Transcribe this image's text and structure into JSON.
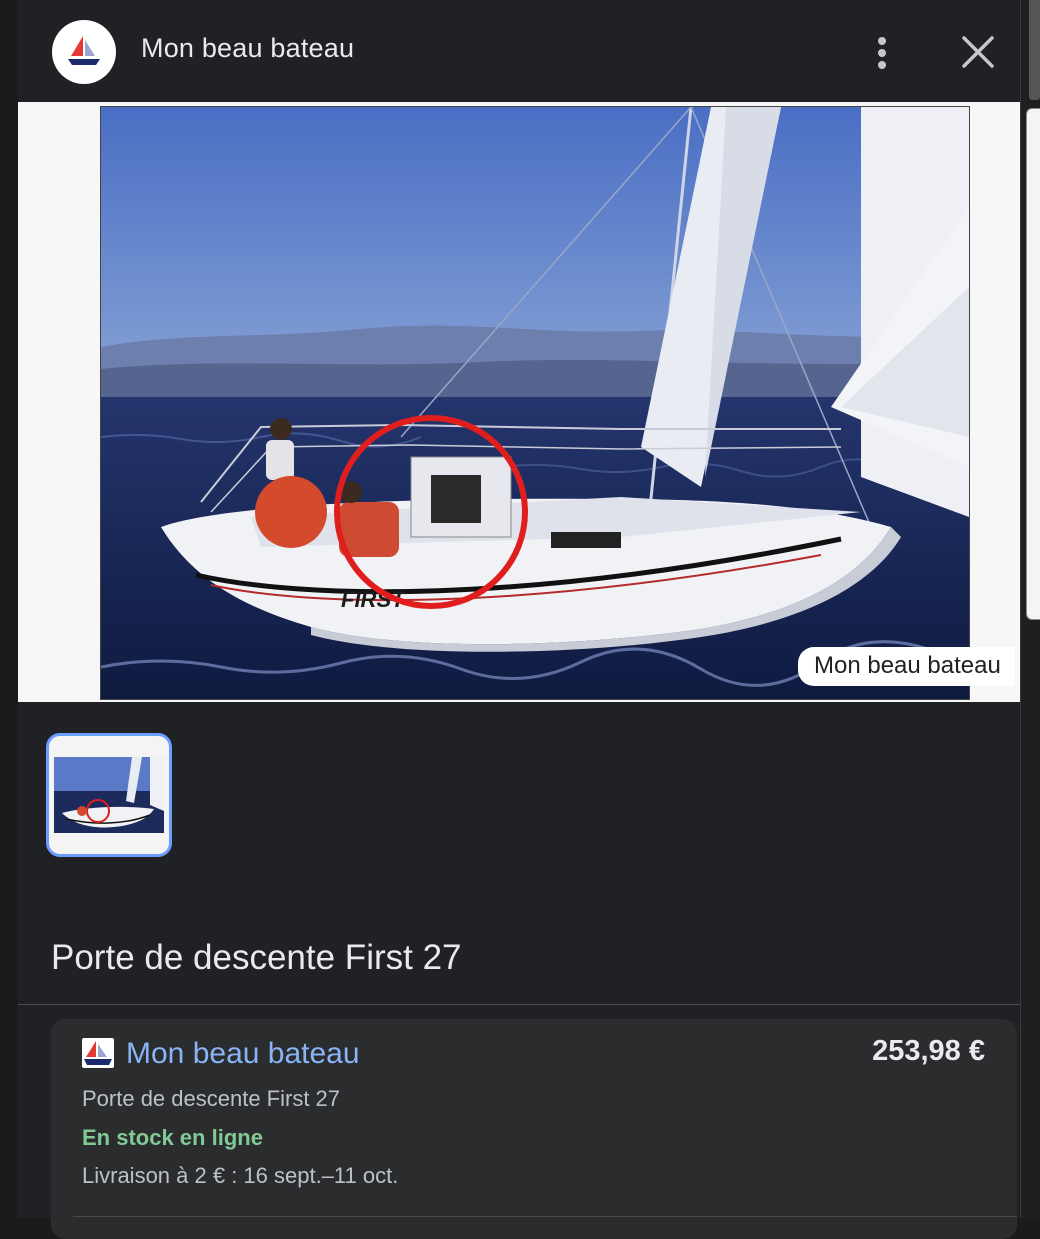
{
  "header": {
    "title": "Mon beau bateau",
    "logo_icon": "sailboat-logo-icon",
    "more_icon": "more-vert-icon",
    "close_icon": "close-icon"
  },
  "image": {
    "source_label": "Mon beau bateau",
    "hull_text": "FIRST"
  },
  "thumbnails": [
    {
      "selected": true
    }
  ],
  "product": {
    "title": "Porte de descente First 27"
  },
  "offer": {
    "seller": "Mon beau bateau",
    "price": "253,98 €",
    "description": "Porte de descente First 27",
    "stock": "En stock en ligne",
    "delivery": "Livraison à 2 € : 16 sept.–11 oct."
  },
  "colors": {
    "link": "#8ab4f8",
    "stock_green": "#81c995",
    "selected_border": "#6c9eff",
    "brand_red": "#e53935",
    "brand_navy": "#1a2a6c"
  }
}
